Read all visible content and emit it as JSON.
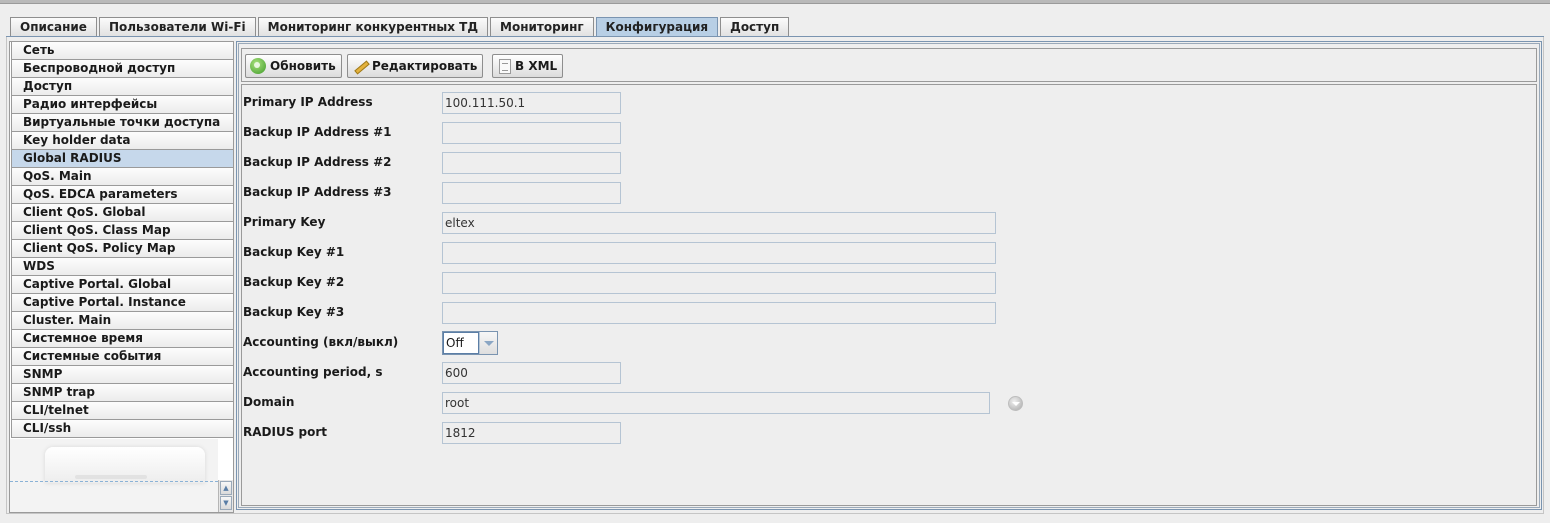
{
  "tabs": [
    {
      "label": "Описание"
    },
    {
      "label": "Пользователи Wi-Fi"
    },
    {
      "label": "Мониторинг конкурентных ТД"
    },
    {
      "label": "Мониторинг"
    },
    {
      "label": "Конфигурация",
      "active": true
    },
    {
      "label": "Доступ"
    }
  ],
  "sidebar": {
    "selected": "Global RADIUS",
    "items": [
      {
        "label": "Сеть"
      },
      {
        "label": "Беспроводной доступ"
      },
      {
        "label": "Доступ"
      },
      {
        "label": "Радио интерфейсы"
      },
      {
        "label": "Виртуальные точки доступа"
      },
      {
        "label": "Key holder data"
      },
      {
        "label": "Global RADIUS"
      },
      {
        "label": "QoS. Main"
      },
      {
        "label": "QoS. EDCA parameters"
      },
      {
        "label": "Client QoS. Global"
      },
      {
        "label": "Client QoS. Class Map"
      },
      {
        "label": "Client QoS. Policy Map"
      },
      {
        "label": "WDS"
      },
      {
        "label": "Captive Portal. Global"
      },
      {
        "label": "Captive Portal. Instance"
      },
      {
        "label": "Cluster. Main"
      },
      {
        "label": "Системное время"
      },
      {
        "label": "Системные события"
      },
      {
        "label": "SNMP"
      },
      {
        "label": "SNMP trap"
      },
      {
        "label": "CLI/telnet"
      },
      {
        "label": "CLI/ssh"
      }
    ]
  },
  "toolbar": {
    "refresh_label": "Обновить",
    "edit_label": "Редактировать",
    "xml_label": "В XML",
    "icons": [
      "refresh-icon",
      "pencil-icon",
      "document-icon"
    ]
  },
  "form": {
    "primary_ip": {
      "label": "Primary IP Address",
      "value": "100.111.50.1"
    },
    "backup_ip_1": {
      "label": "Backup IP Address #1",
      "value": ""
    },
    "backup_ip_2": {
      "label": "Backup IP Address #2",
      "value": ""
    },
    "backup_ip_3": {
      "label": "Backup IP Address #3",
      "value": ""
    },
    "primary_key": {
      "label": "Primary Key",
      "value": "eltex"
    },
    "backup_key_1": {
      "label": "Backup Key #1",
      "value": ""
    },
    "backup_key_2": {
      "label": "Backup Key #2",
      "value": ""
    },
    "backup_key_3": {
      "label": "Backup Key #3",
      "value": ""
    },
    "accounting": {
      "label": "Accounting (вкл/выкл)",
      "value": "Off"
    },
    "accounting_period": {
      "label": "Accounting period, s",
      "value": "600"
    },
    "domain": {
      "label": "Domain",
      "value": "root"
    },
    "radius_port": {
      "label": "RADIUS port",
      "value": "1812"
    }
  },
  "colors": {
    "active_tab": "#b8cfe5",
    "selected_nav": "#c6d8eb",
    "field_border": "#b5c4d3"
  }
}
